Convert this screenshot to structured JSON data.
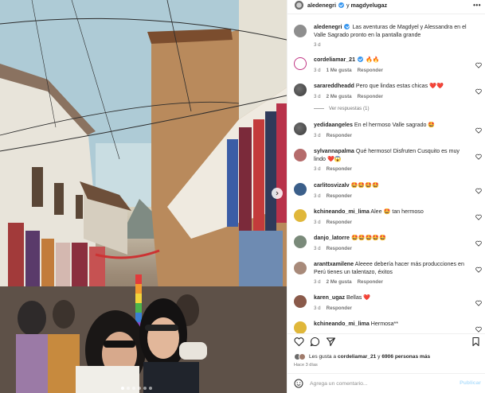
{
  "post": {
    "header": {
      "user1": "aledenegri",
      "joiner": "y",
      "user2": "magdyelugaz",
      "more_icon": "ellipsis-icon"
    },
    "caption": {
      "username": "aledenegri",
      "text": "Las aventuras de Magdyel y Alessandra en el Valle Sagrado pronto en la pantalla grande",
      "time": "3 d"
    },
    "comments": [
      {
        "username": "cordeliamar_21",
        "verified": true,
        "text": "🔥🔥",
        "time": "3 d",
        "likes": "1 Me gusta",
        "reply": "Responder"
      },
      {
        "username": "sarareddheadd",
        "text": "Pero que lindas estas chicas ❤️❤️",
        "time": "3 d",
        "likes": "2 Me gusta",
        "reply": "Responder"
      },
      {
        "username": "yedidaangeles",
        "text": "En el hermoso Valle sagrado 🤩",
        "time": "3 d",
        "reply": "Responder"
      },
      {
        "username": "sylvannapalma",
        "text": "Qué hermoso! Disfruten Cusquito es muy lindo ❤️😱",
        "time": "3 d",
        "reply": "Responder"
      },
      {
        "username": "carlitosvizalv",
        "text": "🤩🤩🤩🤩",
        "time": "3 d",
        "reply": "Responder"
      },
      {
        "username": "kchineando_mi_lima",
        "text": "Alee 🤩 tan hermoso",
        "time": "3 d",
        "reply": "Responder"
      },
      {
        "username": "danjo_latorre",
        "text": "🤩🤩🤩🤩🤩",
        "time": "3 d",
        "reply": "Responder"
      },
      {
        "username": "aranttxamilene",
        "text": "Aleeee debería hacer más producciones en Perú tienes un talentazo, éxitos",
        "time": "3 d",
        "likes": "2 Me gusta",
        "reply": "Responder"
      },
      {
        "username": "karen_ugaz",
        "text": "Bellas ❤️",
        "time": "3 d",
        "reply": "Responder"
      },
      {
        "username": "kchineando_mi_lima",
        "text": "Hermosa**",
        "time": "",
        "reply": ""
      }
    ],
    "view_replies": "Ver respuestas (1)",
    "likes": {
      "prefix": "Les gusta a",
      "user": "cordeliamar_21",
      "middle": "y",
      "count": "6906 personas más"
    },
    "date": "Hace 3 días",
    "add_comment": {
      "placeholder": "Agrega un comentario...",
      "publish": "Publicar"
    },
    "colors": {
      "accent": "#3897f0",
      "heart_red": "#ed4956",
      "publish_disabled": "#b2dffc"
    },
    "carousel": {
      "slides": 6,
      "active": 1
    }
  }
}
